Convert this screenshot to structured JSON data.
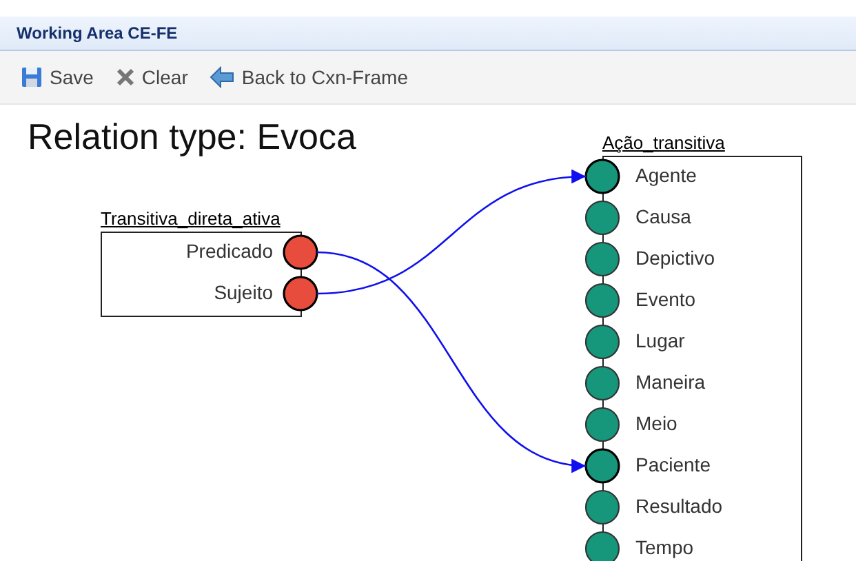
{
  "window": {
    "title": "Working Area CE-FE"
  },
  "toolbar": [
    {
      "kind": "save",
      "label": "Save"
    },
    {
      "kind": "clear",
      "label": "Clear"
    },
    {
      "kind": "back",
      "label": "Back to Cxn-Frame"
    }
  ],
  "heading": "Relation type: Evoca",
  "frames": [
    {
      "title": "Transitiva_direta_ativa",
      "color": "#e74c3c",
      "elements": [
        {
          "label": "Predicado",
          "linked": true
        },
        {
          "label": "Sujeito",
          "linked": true
        }
      ]
    },
    {
      "title": "Ação_transitiva",
      "color": "#16967a",
      "elements": [
        {
          "label": "Agente",
          "linked": true
        },
        {
          "label": "Causa",
          "linked": false
        },
        {
          "label": "Depictivo",
          "linked": false
        },
        {
          "label": "Evento",
          "linked": false
        },
        {
          "label": "Lugar",
          "linked": false
        },
        {
          "label": "Maneira",
          "linked": false
        },
        {
          "label": "Meio",
          "linked": false
        },
        {
          "label": "Paciente",
          "linked": true
        },
        {
          "label": "Resultado",
          "linked": false
        },
        {
          "label": "Tempo",
          "linked": false
        }
      ]
    }
  ]
}
